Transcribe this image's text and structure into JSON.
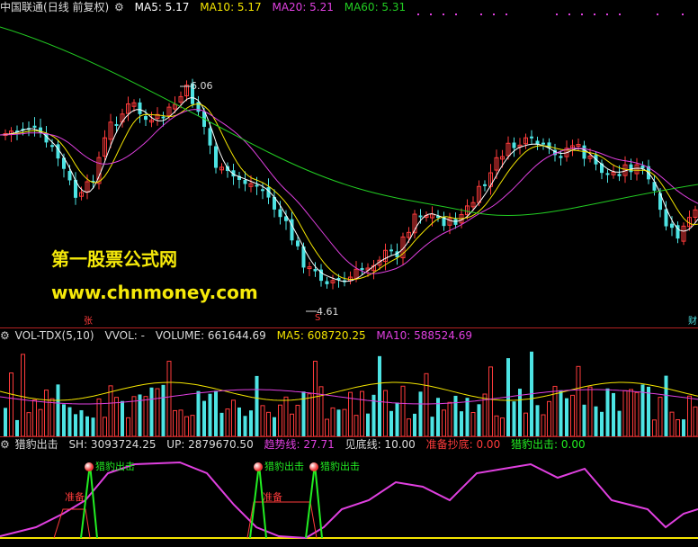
{
  "main": {
    "stock_name": "中国联通",
    "period": "(日线 前复权)",
    "ma5": "MA5: 5.17",
    "ma10": "MA10: 5.17",
    "ma20": "MA20: 5.21",
    "ma60": "MA60: 5.31",
    "high_label": "6.06",
    "low_label": "4.61",
    "watermark_title": "第一股票公式网",
    "watermark_url": "www.chnmoney.com",
    "marker_zhang": "张",
    "marker_s": "S",
    "right_edge_char": "财",
    "colors": {
      "up": "#ff3b3b",
      "down": "#4de3e3",
      "ma5": "#ffffff",
      "ma10": "#f4e500",
      "ma20": "#e040e0",
      "ma60": "#22cc22"
    }
  },
  "volume": {
    "name": "VOL-TDX(5,10)",
    "vvol": "VVOL: -",
    "volume": "VOLUME: 661644.69",
    "ma5": "MA5: 608720.25",
    "ma10": "MA10: 588524.69"
  },
  "indicator": {
    "name": "猎豹出击",
    "sh": "SH: 3093724.25",
    "up": "UP: 2879670.50",
    "trend": "趋势线: 27.71",
    "bottom": "见底线: 10.00",
    "prepare": "准备抄底: 0.00",
    "strike": "猎豹出击: 0.00",
    "signal_label": "猎豹出击",
    "prepare_label": "准备"
  },
  "chart_data": {
    "type": "candlestick",
    "price_high": 6.06,
    "price_low": 4.61,
    "indicator_values": {
      "trend_line": 27.71,
      "bottom_line": 10.0,
      "prepare_bottom": 0.0,
      "cheetah_strike": 0.0
    },
    "volume_last": 661644.69,
    "volume_ma5": 608720.25,
    "volume_ma10": 588524.69
  }
}
